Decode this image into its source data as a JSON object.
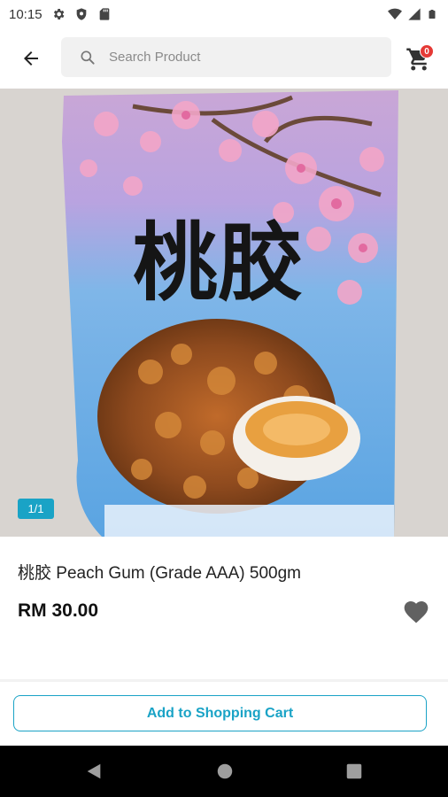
{
  "status_bar": {
    "time": "10:15",
    "icons_left": [
      "gear-icon",
      "shield-icon",
      "sd-card-icon"
    ],
    "icons_right": [
      "wifi-icon",
      "signal-icon",
      "battery-icon"
    ]
  },
  "top_bar": {
    "back_icon": "arrow-left-icon",
    "search_placeholder": "Search Product",
    "cart_icon": "cart-icon",
    "cart_count": "0"
  },
  "product": {
    "image_counter": "1/1",
    "title": "桃胶 Peach Gum (Grade AAA) 500gm",
    "price": "RM 30.00",
    "favorite_icon": "heart-icon",
    "package_text": "桃胶"
  },
  "actions": {
    "add_to_cart_label": "Add to Shopping Cart"
  },
  "nav_bar": {
    "buttons": [
      "back-triangle-icon",
      "home-circle-icon",
      "recents-square-icon"
    ]
  },
  "colors": {
    "accent": "#1aa3c6",
    "badge": "#e53935"
  }
}
